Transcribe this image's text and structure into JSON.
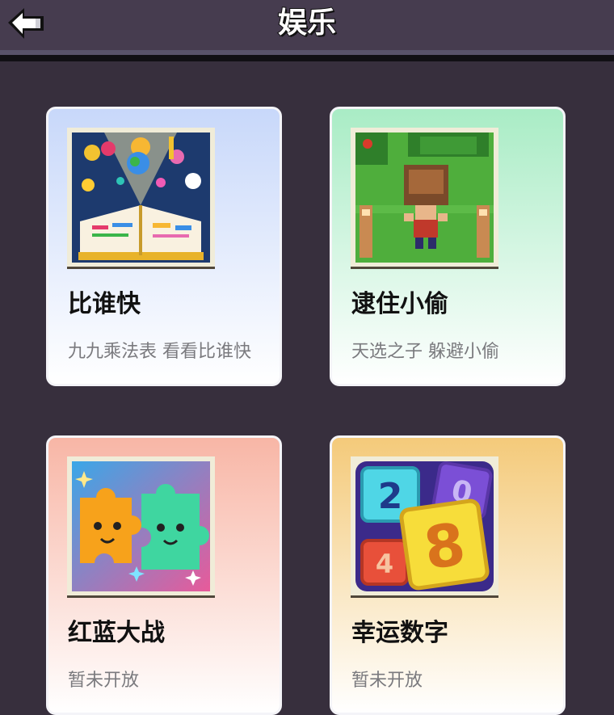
{
  "header": {
    "title": "娱乐",
    "back_icon": "back-arrow-icon",
    "background": "#463c4f"
  },
  "games": [
    {
      "title": "比谁快",
      "description": "九九乘法表 看看比谁快",
      "icon": "open-book-icon",
      "accent": "#c8d8fa"
    },
    {
      "title": "逮住小偷",
      "description": "天选之子 躲避小偷",
      "icon": "pixel-thief-scene-icon",
      "accent": "#a9ecc5"
    },
    {
      "title": "红蓝大战",
      "description": "暂未开放",
      "icon": "puzzle-pieces-icon",
      "accent": "#f8b6a6"
    },
    {
      "title": "幸运数字",
      "description": "暂未开放",
      "icon": "number-tiles-icon",
      "accent": "#f4ca7a"
    }
  ]
}
